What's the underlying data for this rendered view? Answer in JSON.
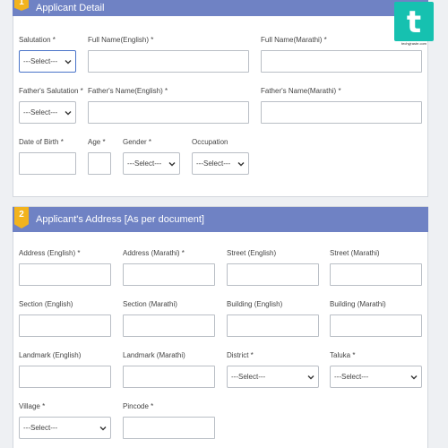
{
  "section1": {
    "number": "1",
    "title": "Applicant Detail"
  },
  "section2": {
    "number": "2",
    "title": "Applicant's Address [As per document]"
  },
  "fields1": {
    "salutation": "Salutation *",
    "full_name_en": "Full Name(English) *",
    "full_name_mr": "Full Name(Marathi) *",
    "father_salutation": "Father's Salutation *",
    "father_name_en": "Father's Name(English) *",
    "father_name_mr": "Father's Name(Marathi) *",
    "dob": "Date of Birth *",
    "age": "Age *",
    "gender": "Gender *",
    "occupation": "Occupation"
  },
  "fields2": {
    "address_en": "Address (English) *",
    "address_mr": "Address (Marathi) *",
    "street_en": "Street (English)",
    "street_mr": "Street (Marathi)",
    "section_en": "Section (English)",
    "section_mr": "Section (Marathi)",
    "building_en": "Building (English)",
    "building_mr": "Building (Marathi)",
    "landmark_en": "Landmark (English)",
    "landmark_mr": "Landmark (Marathi)",
    "district": "District *",
    "taluka": "Taluka *",
    "village": "Village *",
    "pincode": "Pincode *"
  },
  "select_placeholder": "---Select---",
  "watermark": {
    "letter": "t",
    "site": "techyjraste.com"
  },
  "colors": {
    "header": "#6f82c4",
    "badge": "#f2b31d",
    "focus_border": "#4a74c9",
    "logo": "#16c1b0"
  }
}
